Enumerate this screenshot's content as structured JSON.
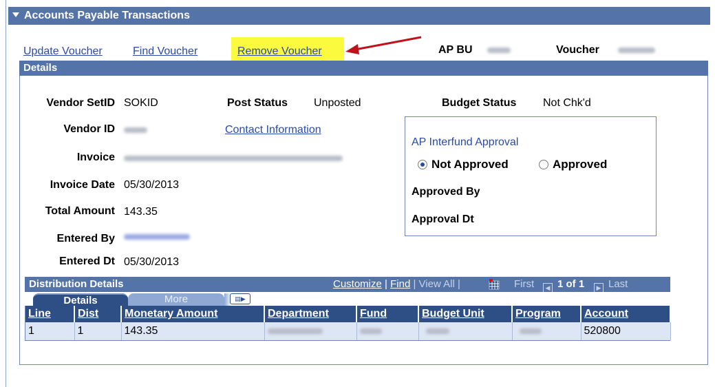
{
  "section": {
    "title": "Accounts Payable Transactions"
  },
  "links": {
    "update_voucher": "Update Voucher",
    "find_voucher": "Find Voucher",
    "remove_voucher": "Remove Voucher"
  },
  "header": {
    "ap_bu_label": "AP BU",
    "voucher_label": "Voucher"
  },
  "details": {
    "title": "Details",
    "vendor_setid_label": "Vendor SetID",
    "vendor_setid_value": "SOKID",
    "post_status_label": "Post Status",
    "post_status_value": "Unposted",
    "budget_status_label": "Budget Status",
    "budget_status_value": "Not Chk'd",
    "vendor_id_label": "Vendor ID",
    "contact_info_link": "Contact Information",
    "invoice_label": "Invoice",
    "invoice_date_label": "Invoice Date",
    "invoice_date_value": "05/30/2013",
    "total_amount_label": "Total Amount",
    "total_amount_value": "143.35",
    "entered_by_label": "Entered By",
    "entered_dt_label": "Entered Dt",
    "entered_dt_value": "05/30/2013"
  },
  "interfund": {
    "title": "AP Interfund Approval",
    "options": [
      "Not Approved",
      "Approved"
    ],
    "selected": "Not Approved",
    "approved_by_label": "Approved By",
    "approval_dt_label": "Approval Dt"
  },
  "distribution": {
    "title": "Distribution Details",
    "customize": "Customize",
    "find": "Find",
    "view_all": "View All",
    "first": "First",
    "range": "1 of 1",
    "last": "Last",
    "tabs": [
      "Details",
      "More"
    ],
    "columns": [
      "Line",
      "Dist",
      "Monetary Amount",
      "Department",
      "Fund",
      "Budget Unit",
      "Program",
      "Account"
    ],
    "rows": [
      {
        "line": "1",
        "dist": "1",
        "amount": "143.35",
        "account": "520800"
      }
    ]
  },
  "colors": {
    "header_blue": "#5473a8",
    "grid_header": "#2e4f85",
    "link_blue": "#2a4aa8",
    "highlight_yellow": "#fbfa3e",
    "annotation_arrow": "#c0121a"
  }
}
